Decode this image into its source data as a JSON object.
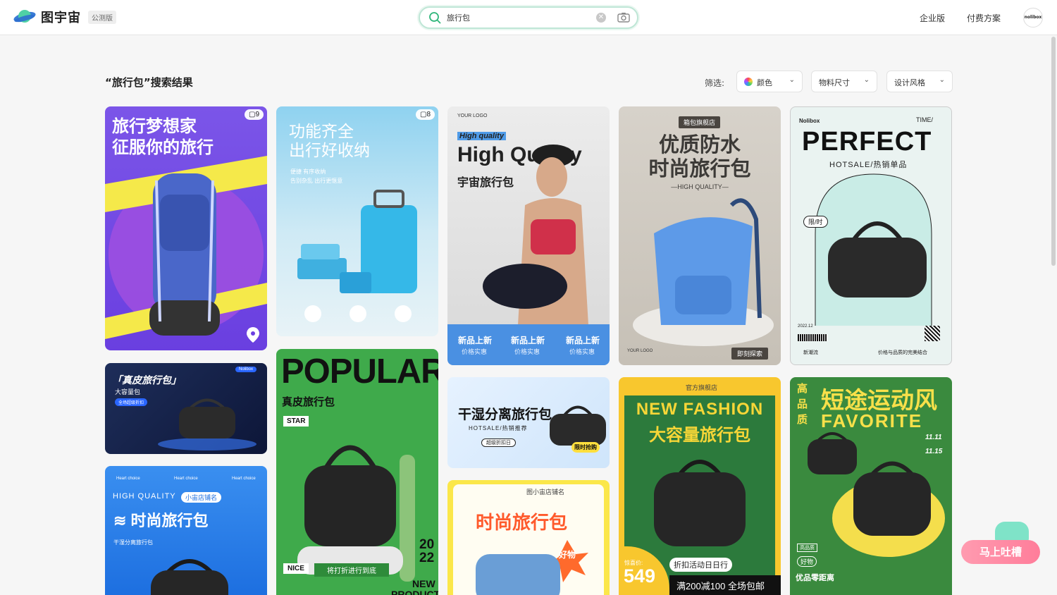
{
  "header": {
    "logo_text": "图宇宙",
    "beta_label": "公测版",
    "search": {
      "value": "旅行包",
      "placeholder": ""
    },
    "nav": [
      "企业版",
      "付费方案"
    ],
    "avatar_text": "nolibox"
  },
  "results": {
    "title": "“旅行包”搜索结果",
    "filter_label": "筛选:",
    "filters": [
      "颜色",
      "物料尺寸",
      "设计风格"
    ]
  },
  "cards": {
    "c1": {
      "badge": "9",
      "line1": "旅行梦想家",
      "line2": "征服你的旅行"
    },
    "c2": {
      "badge": "8",
      "line1": "功能齐全",
      "line2": "出行好收纳",
      "sub1": "便捷 有序收纳",
      "sub2": "告别杂乱 出行更惬意"
    },
    "c3": {
      "logo": "YOUR LOGO",
      "tag": "High quality",
      "title": "High Quality",
      "cn": "宇宙旅行包",
      "b1": "新品上新",
      "b2": "新品上新",
      "b3": "新品上新",
      "s1": "价格实惠",
      "s2": "价格实惠",
      "s3": "价格实惠"
    },
    "c4": {
      "shop": "箱包旗舰店",
      "line1": "优质防水",
      "line2": "时尚旅行包",
      "hq": "—HIGH QUALITY—",
      "logo": "YOUR LOGO",
      "btn": "即刻探索"
    },
    "c5": {
      "brand": "Nolibox",
      "time": "TIME/",
      "title": "PERFECT",
      "hot": "HOTSALE/热销单品",
      "limit": "限/时",
      "date": "2022.12",
      "foot1": "新潮流",
      "foot2": "价格与品质的完美结合"
    },
    "c6": {
      "title": "「真皮旅行包」",
      "sub": "大容量包",
      "tag": "全场超级折扣",
      "badge": "Nolibox"
    },
    "c7": {
      "title": "POPULAR",
      "cn": "真皮旅行包",
      "star": "STAR",
      "nice": "NICE",
      "promo": "将打折进行到底",
      "year1": "20",
      "year2": "22",
      "new": "NEW",
      "product": "PRODUCT"
    },
    "c8": {
      "title": "干湿分离旅行包",
      "hot": "HOTSALE/热销推荐",
      "pill": "超级折扣日",
      "limit": "限时抢购"
    },
    "c9": {
      "shop": "图小宙店铺名",
      "title": "时尚旅行包",
      "good": "好物"
    },
    "c10": {
      "shop": "官方旗舰店",
      "line1": "NEW FASHION",
      "line2": "大容量旅行包",
      "price_label": "惊喜价:",
      "price": "549",
      "promo": "折扣活动日日行",
      "deal": "满200减100 全场包邮"
    },
    "c11": {
      "side": "高品质",
      "title": "短途运动风",
      "en": "FAVORITE",
      "d1": "11.11",
      "d2": "11.15",
      "good": "好物",
      "tag": "高品质",
      "foot": "优品零距离"
    },
    "c12": {
      "hc1": "Heart choice",
      "hc2": "Heart choice",
      "hc3": "Heart choice",
      "hq": "HIGH QUALITY",
      "shop": "小宙店铺名",
      "title": "时尚旅行包",
      "sub": "干湿分离旅行包"
    }
  },
  "feedback_label": "马上吐槽",
  "colors": {
    "accent": "#2fb67a",
    "brand_bg": "#ffffff"
  }
}
